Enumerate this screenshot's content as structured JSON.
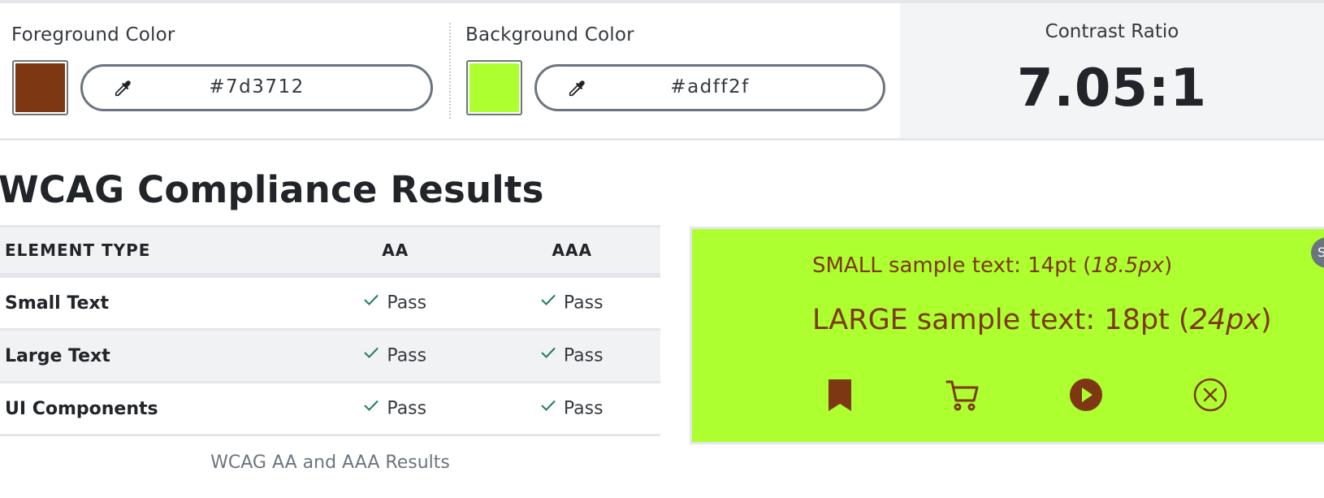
{
  "foreground": {
    "label": "Foreground Color",
    "hex": "#7d3712",
    "swatch_color": "#7d3712",
    "eyedropper_icon": "eyedropper-icon"
  },
  "background": {
    "label": "Background Color",
    "hex": "#adff2f",
    "swatch_color": "#adff2f",
    "eyedropper_icon": "eyedropper-icon"
  },
  "contrast": {
    "label": "Contrast Ratio",
    "value": "7.05:1"
  },
  "results": {
    "title": "WCAG Compliance Results",
    "headers": {
      "type": "ELEMENT TYPE",
      "aa": "AA",
      "aaa": "AAA"
    },
    "rows": [
      {
        "type": "Small Text",
        "aa": "Pass",
        "aaa": "Pass"
      },
      {
        "type": "Large Text",
        "aa": "Pass",
        "aaa": "Pass"
      },
      {
        "type": "UI Components",
        "aa": "Pass",
        "aaa": "Pass"
      }
    ],
    "caption": "WCAG AA and AAA Results",
    "pass_color": "#1e7b5e"
  },
  "preview": {
    "small_prefix": "SMALL sample text: 14pt (",
    "small_px": "18.5px",
    "small_suffix": ")",
    "large_prefix": "LARGE sample text: 18pt (",
    "large_px": "24px",
    "large_suffix": ")",
    "icons": [
      "bookmark-icon",
      "cart-icon",
      "play-icon",
      "close-circle-icon"
    ],
    "badge_text": "S"
  }
}
